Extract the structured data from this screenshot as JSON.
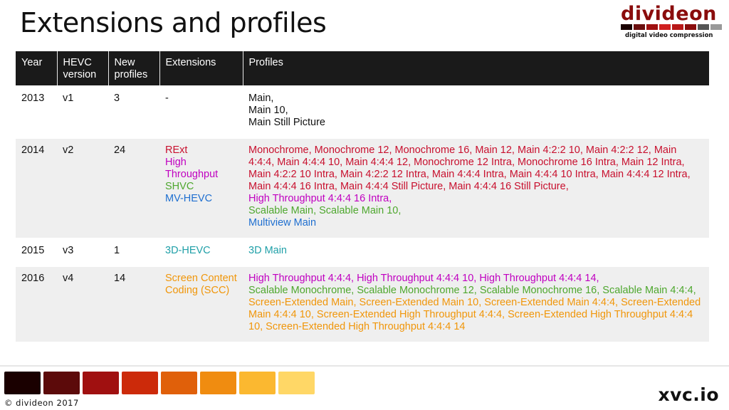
{
  "title": "Extensions and profiles",
  "logo": {
    "word": "divideon",
    "tagline": "digital video compression",
    "bar_colors": [
      "#1a0000",
      "#6b0f0f",
      "#a01010",
      "#d02020",
      "#b81818",
      "#8a0c0c",
      "#555555",
      "#999999"
    ]
  },
  "table": {
    "headers": [
      "Year",
      "HEVC version",
      "New profiles",
      "Extensions",
      "Profiles"
    ],
    "rows": [
      {
        "year": "2013",
        "version": "v1",
        "new_profiles": "3",
        "extensions": [
          {
            "text": "-",
            "color": "black"
          }
        ],
        "profiles": [
          {
            "text": "Main,",
            "color": "black"
          },
          {
            "text": "Main 10,",
            "color": "black"
          },
          {
            "text": "Main Still Picture",
            "color": "black"
          }
        ]
      },
      {
        "year": "2014",
        "version": "v2",
        "new_profiles": "24",
        "extensions": [
          {
            "text": "RExt",
            "color": "red"
          },
          {
            "text": "High Throughput",
            "color": "magenta"
          },
          {
            "text": "SHVC",
            "color": "green"
          },
          {
            "text": "MV-HEVC",
            "color": "blue"
          }
        ],
        "profiles": [
          {
            "text": "Monochrome, Monochrome 12, Monochrome 16, Main 12, Main 4:2:2 10, Main 4:2:2 12, Main 4:4:4, Main 4:4:4 10, Main 4:4:4 12, Monochrome 12 Intra, Monochrome 16 Intra, Main 12 Intra, Main 4:2:2 10 Intra, Main 4:2:2 12 Intra, Main 4:4:4 Intra, Main 4:4:4 10 Intra, Main 4:4:4 12 Intra, Main 4:4:4 16 Intra, Main 4:4:4 Still Picture, Main 4:4:4 16 Still Picture,",
            "color": "red"
          },
          {
            "text": "High Throughput 4:4:4 16 Intra,",
            "color": "magenta"
          },
          {
            "text": "Scalable Main, Scalable Main 10,",
            "color": "green"
          },
          {
            "text": "Multiview Main",
            "color": "blue"
          }
        ]
      },
      {
        "year": "2015",
        "version": "v3",
        "new_profiles": "1",
        "extensions": [
          {
            "text": "3D-HEVC",
            "color": "teal"
          }
        ],
        "profiles": [
          {
            "text": "3D Main",
            "color": "teal"
          }
        ]
      },
      {
        "year": "2016",
        "version": "v4",
        "new_profiles": "14",
        "extensions": [
          {
            "text": "Screen Content Coding (SCC)",
            "color": "orange"
          }
        ],
        "profiles": [
          {
            "text": "High Throughput 4:4:4, High Throughput 4:4:4 10, High Throughput 4:4:4 14,",
            "color": "magenta"
          },
          {
            "text": "Scalable Monochrome, Scalable Monochrome 12, Scalable Monochrome 16, Scalable Main 4:4:4,",
            "color": "green"
          },
          {
            "text": "Screen-Extended Main, Screen-Extended Main 10, Screen-Extended Main 4:4:4, Screen-Extended Main 4:4:4 10, Screen-Extended High Throughput 4:4:4, Screen-Extended High Throughput 4:4:4 10, Screen-Extended High Throughput 4:4:4 14",
            "color": "orange"
          }
        ]
      }
    ]
  },
  "footer": {
    "swatch_colors": [
      "#1a0000",
      "#5c0a0a",
      "#a01010",
      "#cc2a0a",
      "#e0600a",
      "#f08c10",
      "#fbb830",
      "#ffd766"
    ],
    "copyright": "© divideon 2017",
    "site": "xvc.io"
  },
  "colors": {
    "black": "#111111",
    "red": "#c8102e",
    "magenta": "#c000c0",
    "green": "#4ea72e",
    "blue": "#1f6fd0",
    "teal": "#20a0a8",
    "orange": "#f0960a"
  }
}
